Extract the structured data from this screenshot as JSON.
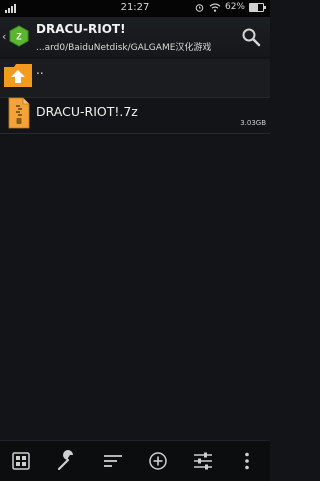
{
  "status_bar": {
    "time": "21:27",
    "battery_text": "62%",
    "battery_level": 0.62
  },
  "header": {
    "title": "DRACU-RIOT!",
    "path": "...ard0/BaiduNetdisk/GALGAME汉化游戏"
  },
  "file_list": {
    "parent_label": "..",
    "items": [
      {
        "name": "DRACU-RIOT!.7z",
        "size": "3.03GB"
      }
    ]
  },
  "icons": {
    "app": "zarchiver-logo-icon",
    "search": "search-icon",
    "toolbar": [
      "grid-icon",
      "wrench-icon",
      "sort-lines-icon",
      "add-circle-icon",
      "sliders-icon",
      "more-vertical-icon"
    ]
  },
  "colors": {
    "accent": "#5cb531",
    "folder": "#f39a1f",
    "background": "#121417"
  }
}
